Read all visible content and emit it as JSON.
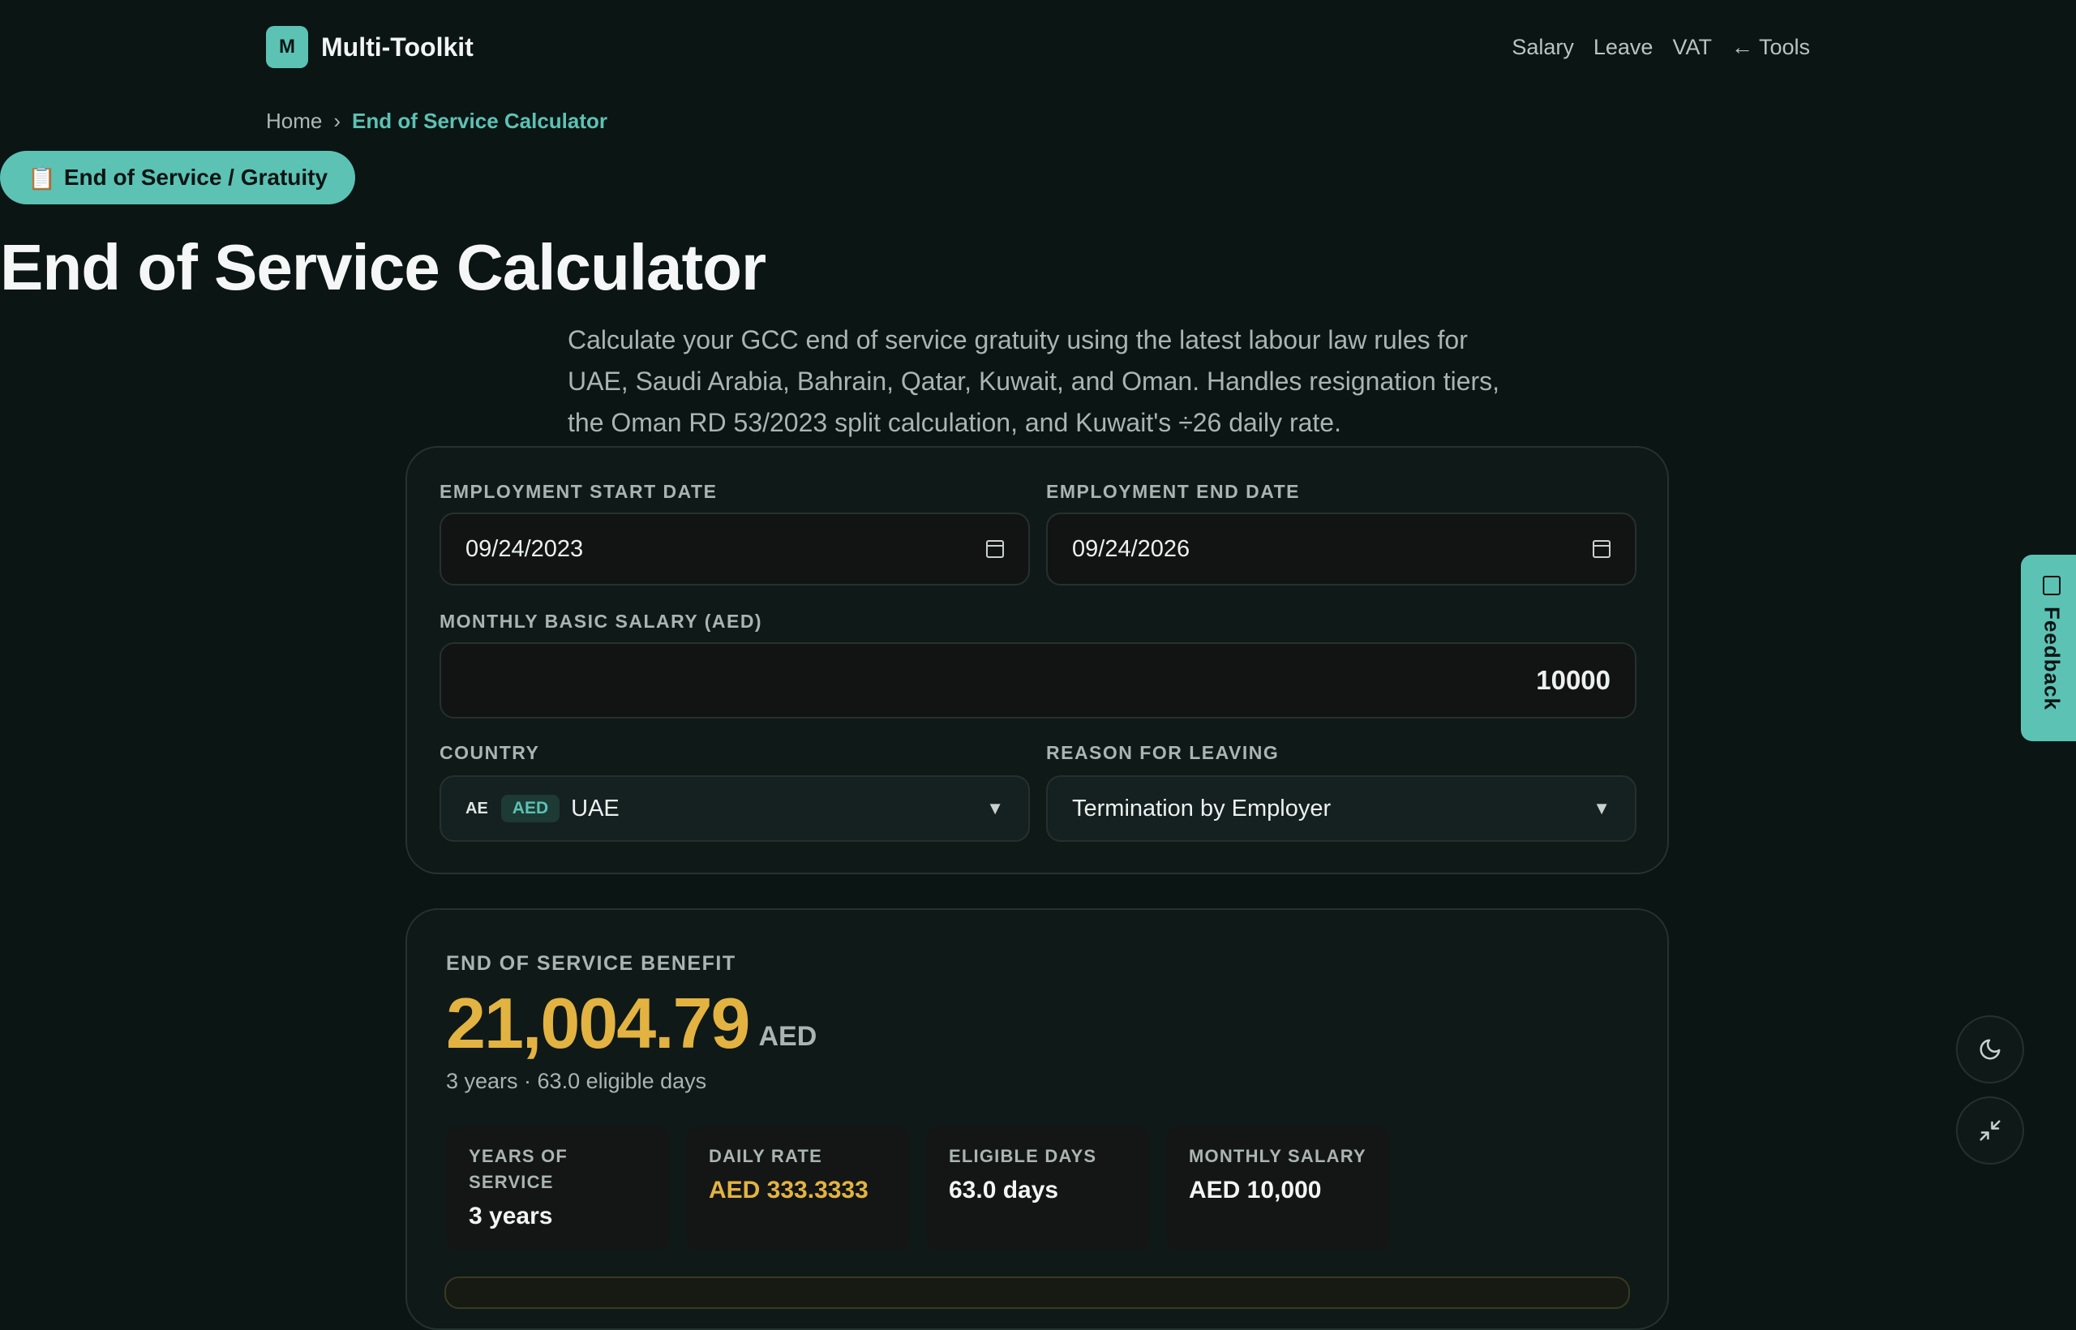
{
  "header": {
    "logo_letter": "M",
    "brand": "Multi-Toolkit",
    "nav": [
      "Salary",
      "Leave",
      "VAT",
      "← Tools"
    ]
  },
  "breadcrumb": {
    "home": "Home",
    "separator": "›",
    "current": "End of Service Calculator"
  },
  "badge": {
    "emoji": "📋",
    "label": "End of Service / Gratuity"
  },
  "page_title": "End of Service Calculator",
  "description": "Calculate your GCC end of service gratuity using the latest labour law rules for UAE, Saudi Arabia, Bahrain, Qatar, Kuwait, and Oman. Handles resignation tiers, the Oman RD 53/2023 split calculation, and Kuwait's ÷26 daily rate.",
  "form": {
    "start_label": "EMPLOYMENT START DATE",
    "start_value": "09/24/2023",
    "end_label": "EMPLOYMENT END DATE",
    "end_value": "09/24/2026",
    "salary_label": "MONTHLY BASIC SALARY (AED)",
    "salary_value": "10000",
    "country_label": "COUNTRY",
    "country_code": "AE",
    "country_currency": "AED",
    "country_value": "UAE",
    "reason_label": "REASON FOR LEAVING",
    "reason_value": "Termination by Employer"
  },
  "result": {
    "label": "END OF SERVICE BENEFIT",
    "amount": "21,004.79",
    "unit": "AED",
    "summary": "3 years · 63.0 eligible days",
    "stats": [
      {
        "label": "YEARS OF SERVICE",
        "value": "3 years"
      },
      {
        "label": "DAILY RATE",
        "value": "AED 333.3333"
      },
      {
        "label": "ELIGIBLE DAYS",
        "value": "63.0 days"
      },
      {
        "label": "MONTHLY SALARY",
        "value": "AED 10,000"
      }
    ]
  },
  "feedback_label": "Feedback",
  "colors": {
    "accent": "#5cc2b4",
    "highlight": "#e3b341",
    "background": "#0b1514"
  },
  "icons": [
    "calendar-icon",
    "chevron-down-icon",
    "moon-icon",
    "collapse-icon",
    "feedback-icon"
  ]
}
